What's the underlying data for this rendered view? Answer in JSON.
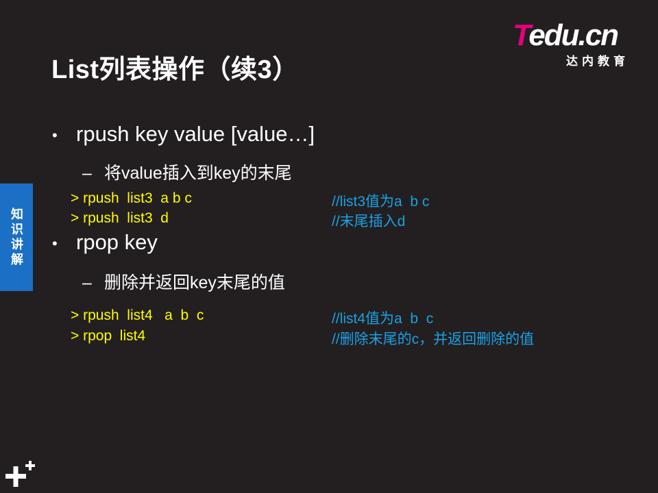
{
  "slide": {
    "title": "List列表操作（续3）",
    "side_tab": "知识讲解",
    "brand": {
      "logo_t": "T",
      "logo_rest": "edu.cn",
      "logo_sub": "达内教育"
    },
    "sections": [
      {
        "bullet": "•",
        "heading": "rpush key value [value…]",
        "dash": "–",
        "description": "将value插入到key的末尾",
        "commands": [
          {
            "cmd": "> rpush  list3  a b c",
            "comment": "//list3值为a  b c"
          },
          {
            "cmd": "> rpush  list3  d",
            "comment": "//末尾插入d"
          }
        ]
      },
      {
        "bullet": "•",
        "heading": "rpop key",
        "dash": "–",
        "description": "删除并返回key末尾的值",
        "commands": [
          {
            "cmd": "> rpush  list4   a  b  c",
            "comment": "//list4值为a  b  c"
          },
          {
            "cmd": "> rpop  list4",
            "comment": "//删除末尾的c，并返回删除的值"
          }
        ]
      }
    ]
  }
}
